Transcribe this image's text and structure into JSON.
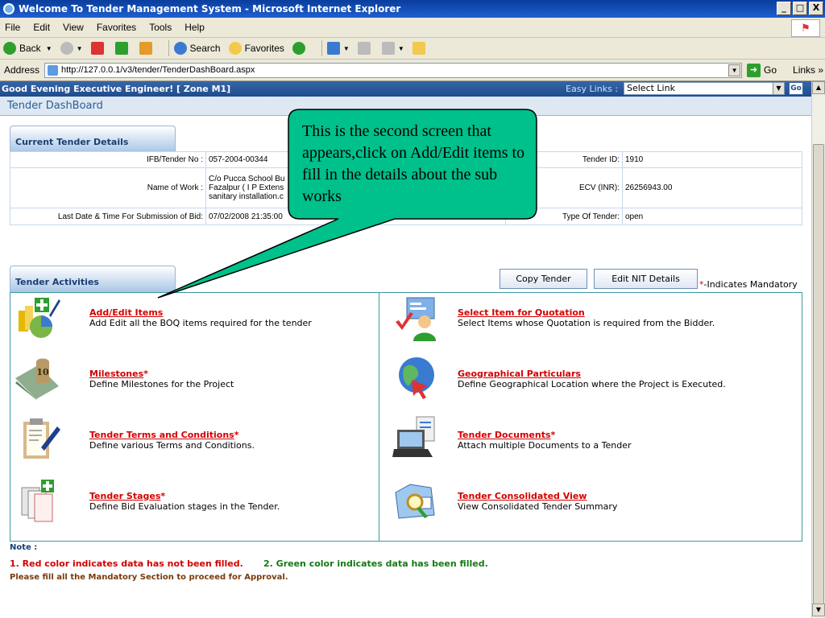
{
  "window": {
    "title": "Welcome To Tender Management System - Microsoft Internet Explorer",
    "min": "_",
    "max": "□",
    "close": "X"
  },
  "menu": [
    "File",
    "Edit",
    "View",
    "Favorites",
    "Tools",
    "Help"
  ],
  "toolbar": {
    "back": "Back",
    "search": "Search",
    "favorites": "Favorites"
  },
  "address": {
    "label": "Address",
    "url": "http://127.0.0.1/v3/tender/TenderDashBoard.aspx",
    "go": "Go",
    "links": "Links",
    "links_more": "»"
  },
  "appbar": {
    "greeting": "Good Evening Executive Engineer!   [ Zone M1]",
    "easy_links": "Easy Links :",
    "select_value": "Select Link",
    "go": "Go"
  },
  "page": {
    "title": "Tender DashBoard"
  },
  "details": {
    "tab_label": "Current Tender Details",
    "ifb_label": "IFB/Tender No :",
    "ifb_value": "057-2004-00344",
    "tender_id_label": "Tender ID:",
    "tender_id_value": "1910",
    "work_label": "Name of Work :",
    "work_line1": "C/o Pucca School Bu",
    "work_line2": "Fazalpur ( I P Extens",
    "work_line3": "sanitary installation.c",
    "ecv_label": "ECV (INR):",
    "ecv_value": "26256943.00",
    "lastdate_label": "Last Date & Time For Submission of Bid:",
    "lastdate_value": "07/02/2008 21:35:00",
    "type_label": "Type Of Tender:",
    "type_value": "open"
  },
  "activities": {
    "tab_label": "Tender Activities",
    "copy_button": "Copy Tender",
    "edit_nit_button": "Edit NIT Details",
    "mandatory_star": "*",
    "mandatory_text": "-Indicates Mandatory",
    "items": [
      {
        "title": "Add/Edit Items",
        "star": "",
        "desc": "Add Edit all the BOQ items required for the tender"
      },
      {
        "title": "Select Item for Quotation",
        "star": "",
        "desc": "Select Items whose Quotation is required from the Bidder."
      },
      {
        "title": "Milestones",
        "star": "*",
        "desc": "Define Milestones for the Project"
      },
      {
        "title": "Geographical Particulars",
        "star": "",
        "desc": "Define Geographical Location where the Project is Executed."
      },
      {
        "title": "Tender Terms and Conditions",
        "star": "*",
        "desc": "Define various Terms and Conditions."
      },
      {
        "title": "Tender Documents",
        "star": "*",
        "desc": "Attach multiple Documents to a Tender"
      },
      {
        "title": "Tender Stages",
        "star": "*",
        "desc": "Define Bid Evaluation stages in the Tender."
      },
      {
        "title": "Tender Consolidated View",
        "star": "",
        "desc": "View Consolidated Tender Summary"
      }
    ],
    "milestone_badge": "10"
  },
  "notes": {
    "label": "Note :",
    "red": "1. Red color indicates data has not been filled.",
    "green": "2. Green color indicates data has been filled.",
    "brown": "Please fill all the Mandatory Section to proceed for Approval."
  },
  "callout": {
    "text": "This is the second screen that appears,click on Add/Edit items to fill in the details about the sub works"
  },
  "colors": {
    "callout_fill": "#00c08b",
    "link_red": "#d40000",
    "header_blue": "#2c5d99"
  }
}
